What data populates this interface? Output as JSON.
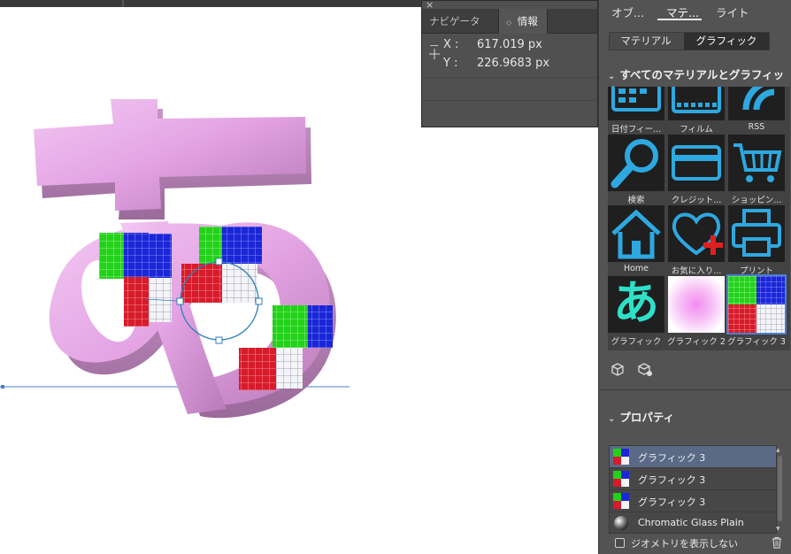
{
  "info_panel": {
    "close_glyph": "×",
    "tabs": [
      {
        "label": "ナビゲーター"
      },
      {
        "label": "情報",
        "arrows": "◇"
      }
    ],
    "x_label": "X :",
    "x_value": "617.019 px",
    "y_label": "Y :",
    "y_value": "226.9683 px"
  },
  "right_panel": {
    "main_tabs": [
      "オブ...",
      "マテ...",
      "ライト"
    ],
    "active_main_tab": 1,
    "segments": [
      "マテリアル",
      "グラフィック"
    ],
    "active_segment": 1,
    "section_all": {
      "chevron": "⌄",
      "label": "すべてのマテリアルとグラフィック"
    },
    "tiles": [
      {
        "label": "日付フィー...",
        "icon": "calendar-icon"
      },
      {
        "label": "フィルム",
        "icon": "film-icon"
      },
      {
        "label": "RSS",
        "icon": "rss-icon"
      },
      {
        "label": "検索",
        "icon": "search-icon"
      },
      {
        "label": "クレジット...",
        "icon": "credit-card-icon"
      },
      {
        "label": "ショッピン...",
        "icon": "shopping-cart-icon"
      },
      {
        "label": "Home",
        "icon": "home-icon"
      },
      {
        "label": "お気に入り...",
        "icon": "heart-plus-icon"
      },
      {
        "label": "プリント",
        "icon": "printer-icon"
      },
      {
        "label": "グラフィック",
        "icon": "hiragana-a-graphic",
        "glyph": "あ"
      },
      {
        "label": "グラフィック 2",
        "icon": "pink-gradient-graphic"
      },
      {
        "label": "グラフィック 3",
        "icon": "checker-graphic",
        "selected": true
      }
    ],
    "section_props": {
      "chevron": "⌄",
      "label": "プロパティ"
    },
    "property_rows": [
      {
        "label": "グラフィック 3",
        "thumb": "checker-graphic",
        "selected": true
      },
      {
        "label": "グラフィック 3",
        "thumb": "checker-graphic"
      },
      {
        "label": "グラフィック 3",
        "thumb": "checker-graphic"
      },
      {
        "label": "Chromatic Glass Plain",
        "thumb": "glass-sphere-icon"
      }
    ],
    "show_geometry_label": "ジオメトリを表示しない",
    "show_geometry_checked": false
  },
  "colors": {
    "accent": "#4a7fd0",
    "icon_blue": "#2ea8e0",
    "letter_pink": "#e8a6e8",
    "selection_blue": "#5a6a86"
  }
}
